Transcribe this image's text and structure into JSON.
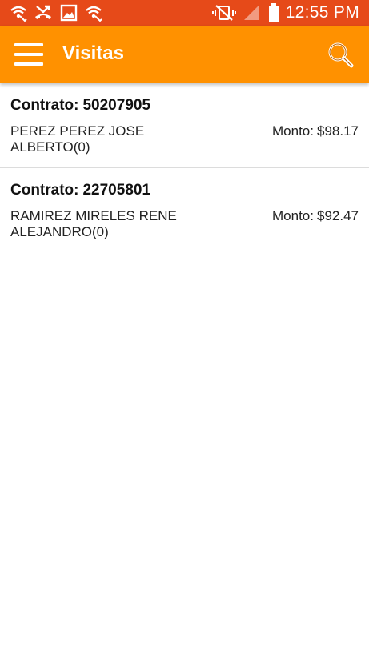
{
  "status_bar": {
    "time": "12:55 PM",
    "icons": [
      "wifi-call-icon",
      "missed-call-icon",
      "gallery-icon",
      "wifi-call-icon",
      "vibrate-mute-icon",
      "signal-icon",
      "battery-icon"
    ],
    "color": "#e64a19"
  },
  "app_bar": {
    "title": "Visitas",
    "menu_icon": "hamburger-menu-icon",
    "search_icon": "search-icon",
    "color": "#ff9100"
  },
  "visits": [
    {
      "contract_label": "Contrato:",
      "contract_number": "50207905",
      "client_name": "PEREZ PEREZ JOSE ALBERTO(0)",
      "amount_label": "Monto:",
      "amount_value": "$98.17"
    },
    {
      "contract_label": "Contrato:",
      "contract_number": "22705801",
      "client_name": "RAMIREZ MIRELES RENE ALEJANDRO(0)",
      "amount_label": "Monto:",
      "amount_value": "$92.47"
    }
  ]
}
